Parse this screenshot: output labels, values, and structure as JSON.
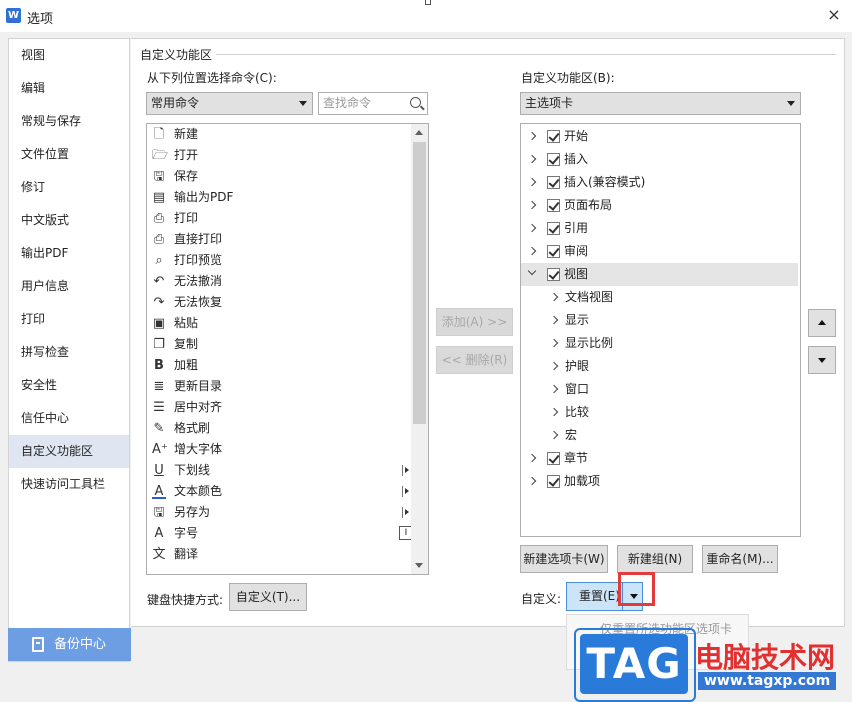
{
  "window": {
    "title": "选项",
    "app_icon": "W",
    "close_glyph": "×"
  },
  "sidebar": {
    "items": [
      {
        "label": "视图"
      },
      {
        "label": "编辑"
      },
      {
        "label": "常规与保存"
      },
      {
        "label": "文件位置"
      },
      {
        "label": "修订"
      },
      {
        "label": "中文版式"
      },
      {
        "label": "输出PDF"
      },
      {
        "label": "用户信息"
      },
      {
        "label": "打印"
      },
      {
        "label": "拼写检查"
      },
      {
        "label": "安全性"
      },
      {
        "label": "信任中心"
      },
      {
        "label": "自定义功能区",
        "active": true
      },
      {
        "label": "快速访问工具栏"
      }
    ],
    "backup_label": "备份中心"
  },
  "main": {
    "section_title": "自定义功能区",
    "left": {
      "choose_label": "从下列位置选择命令(C):",
      "source_value": "常用命令",
      "search_placeholder": "查找命令",
      "commands": [
        {
          "label": "新建",
          "icon": "new-doc-icon",
          "glyph": "🗋"
        },
        {
          "label": "打开",
          "icon": "folder-open-icon",
          "glyph": "🗁"
        },
        {
          "label": "保存",
          "icon": "save-icon",
          "glyph": "🖫"
        },
        {
          "label": "输出为PDF",
          "icon": "pdf-icon",
          "glyph": "▤"
        },
        {
          "label": "打印",
          "icon": "printer-icon",
          "glyph": "⎙"
        },
        {
          "label": "直接打印",
          "icon": "direct-print-icon",
          "glyph": "⎙"
        },
        {
          "label": "打印预览",
          "icon": "print-preview-icon",
          "glyph": "⌕"
        },
        {
          "label": "无法撤消",
          "icon": "undo-icon",
          "glyph": "↶"
        },
        {
          "label": "无法恢复",
          "icon": "redo-icon",
          "glyph": "↷"
        },
        {
          "label": "粘贴",
          "icon": "paste-icon",
          "glyph": "▣"
        },
        {
          "label": "复制",
          "icon": "copy-icon",
          "glyph": "❐"
        },
        {
          "label": "加粗",
          "icon": "bold-icon",
          "glyph": "B"
        },
        {
          "label": "更新目录",
          "icon": "update-toc-icon",
          "glyph": "≣"
        },
        {
          "label": "居中对齐",
          "icon": "align-center-icon",
          "glyph": "☰"
        },
        {
          "label": "格式刷",
          "icon": "format-painter-icon",
          "glyph": "✎"
        },
        {
          "label": "增大字体",
          "icon": "grow-font-icon",
          "glyph": "A⁺"
        },
        {
          "label": "下划线",
          "icon": "underline-icon",
          "glyph": "U",
          "submenu": true
        },
        {
          "label": "文本颜色",
          "icon": "text-color-icon",
          "glyph": "A",
          "submenu": true
        },
        {
          "label": "另存为",
          "icon": "save-as-icon",
          "glyph": "🖫",
          "submenu": true
        },
        {
          "label": "字号",
          "icon": "font-size-icon",
          "glyph": "A",
          "box": true
        },
        {
          "label": "翻译",
          "icon": "translate-icon",
          "glyph": "文"
        }
      ],
      "shortcut_label": "键盘快捷方式:",
      "shortcut_button": "自定义(T)..."
    },
    "middle": {
      "add_button": "添加(A) >>",
      "remove_button": "<< 删除(R)"
    },
    "right": {
      "ribbon_label": "自定义功能区(B):",
      "ribbon_value": "主选项卡",
      "tree": [
        {
          "label": "开始",
          "level": 0,
          "checked": true
        },
        {
          "label": "插入",
          "level": 0,
          "checked": true
        },
        {
          "label": "插入(兼容模式)",
          "level": 0,
          "checked": true
        },
        {
          "label": "页面布局",
          "level": 0,
          "checked": true
        },
        {
          "label": "引用",
          "level": 0,
          "checked": true
        },
        {
          "label": "审阅",
          "level": 0,
          "checked": true
        },
        {
          "label": "视图",
          "level": 0,
          "checked": true,
          "expanded": true,
          "selected": true
        },
        {
          "label": "文档视图",
          "level": 1
        },
        {
          "label": "显示",
          "level": 1
        },
        {
          "label": "显示比例",
          "level": 1
        },
        {
          "label": "护眼",
          "level": 1
        },
        {
          "label": "窗口",
          "level": 1
        },
        {
          "label": "比较",
          "level": 1
        },
        {
          "label": "宏",
          "level": 1
        },
        {
          "label": "章节",
          "level": 0,
          "checked": true
        },
        {
          "label": "加载项",
          "level": 0,
          "checked": true
        }
      ],
      "new_tab_button": "新建选项卡(W)",
      "new_group_button": "新建组(N)",
      "rename_button": "重命名(M)...",
      "custom_label": "自定义:",
      "reset_button": "重置(E)",
      "reset_menu_option": "仅重置所选功能区选项卡"
    }
  },
  "watermark": {
    "tag": "TAG",
    "title": "电脑技术网",
    "url": "www.tagxp.com"
  }
}
